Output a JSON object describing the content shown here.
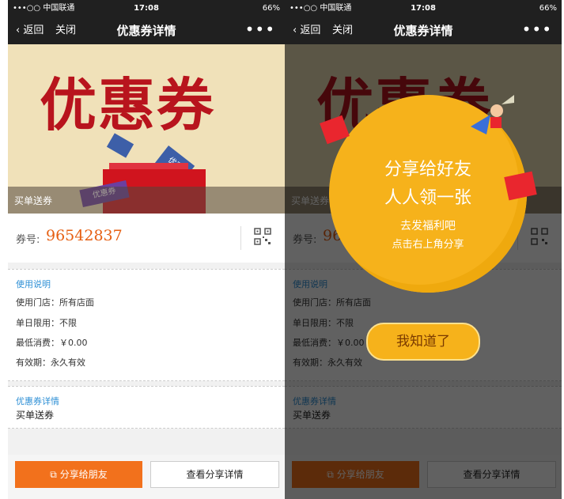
{
  "status": {
    "carrier": "•••○○ 中国联通",
    "time": "17:08",
    "battery": "66%"
  },
  "nav": {
    "back": "返回",
    "close": "关闭",
    "title": "优惠券详情",
    "more": "•••"
  },
  "banner": {
    "big_text": "优惠券",
    "caption": "买单送券",
    "tag1": "优惠券",
    "tag2": "优惠"
  },
  "coupon": {
    "label": "券号:",
    "number": "96542837"
  },
  "usage": {
    "heading": "使用说明",
    "rows": [
      "使用门店：所有店面",
      "单日限用：不限",
      "最低消费：￥0.00",
      "有效期：永久有效"
    ]
  },
  "detail": {
    "heading": "优惠券详情",
    "value": "买单送券"
  },
  "buttons": {
    "share": "分享给朋友",
    "view": "查看分享详情"
  },
  "popup": {
    "title1": "分享给好友",
    "title2": "人人领一张",
    "sub1": "去发福利吧",
    "sub2": "点击右上角分享",
    "ok": "我知道了"
  },
  "colors": {
    "accent": "#f2711c",
    "link": "#2d8fd5",
    "popup": "#f6b21b"
  }
}
